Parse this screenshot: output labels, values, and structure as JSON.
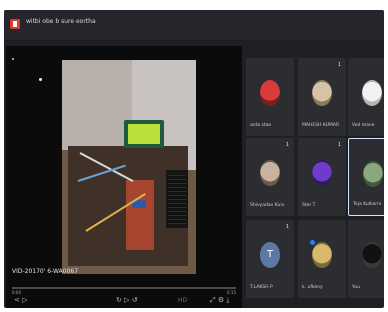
{
  "window": {
    "title": "witbi obe b sure eortha",
    "app_icon": "app-logo-icon"
  },
  "video": {
    "caption": "VID-20170' 6-WA0067",
    "time_current": "0:00",
    "time_total": "0:15",
    "progress_fraction": 0.0,
    "controls": {
      "left": "< ▷",
      "middle": "↻ ▷ ↺",
      "hd_label": "HD",
      "right": "⤢ ⚙ ⤓"
    }
  },
  "participants": [
    {
      "name": "anta stae",
      "number": "",
      "avatar": "red"
    },
    {
      "name": "MAHESH KUMAR",
      "number": "1",
      "avatar": "tan"
    },
    {
      "name": "Ved mane",
      "number": "1",
      "avatar": "white"
    },
    {
      "name": "Shivyadav Kuin",
      "number": "1",
      "avatar": "skin"
    },
    {
      "name": "Ster T",
      "number": "1",
      "avatar": "purple"
    },
    {
      "name": "Teja Kulkarni",
      "number": "",
      "avatar": "green",
      "active": true
    },
    {
      "name": "T.LAKSH P",
      "number": "1",
      "avatar_letter": "T"
    },
    {
      "name": "k. ufkeny",
      "number": "",
      "avatar": "yellow"
    },
    {
      "name": "Yuu",
      "number": "",
      "avatar": "black"
    }
  ]
}
